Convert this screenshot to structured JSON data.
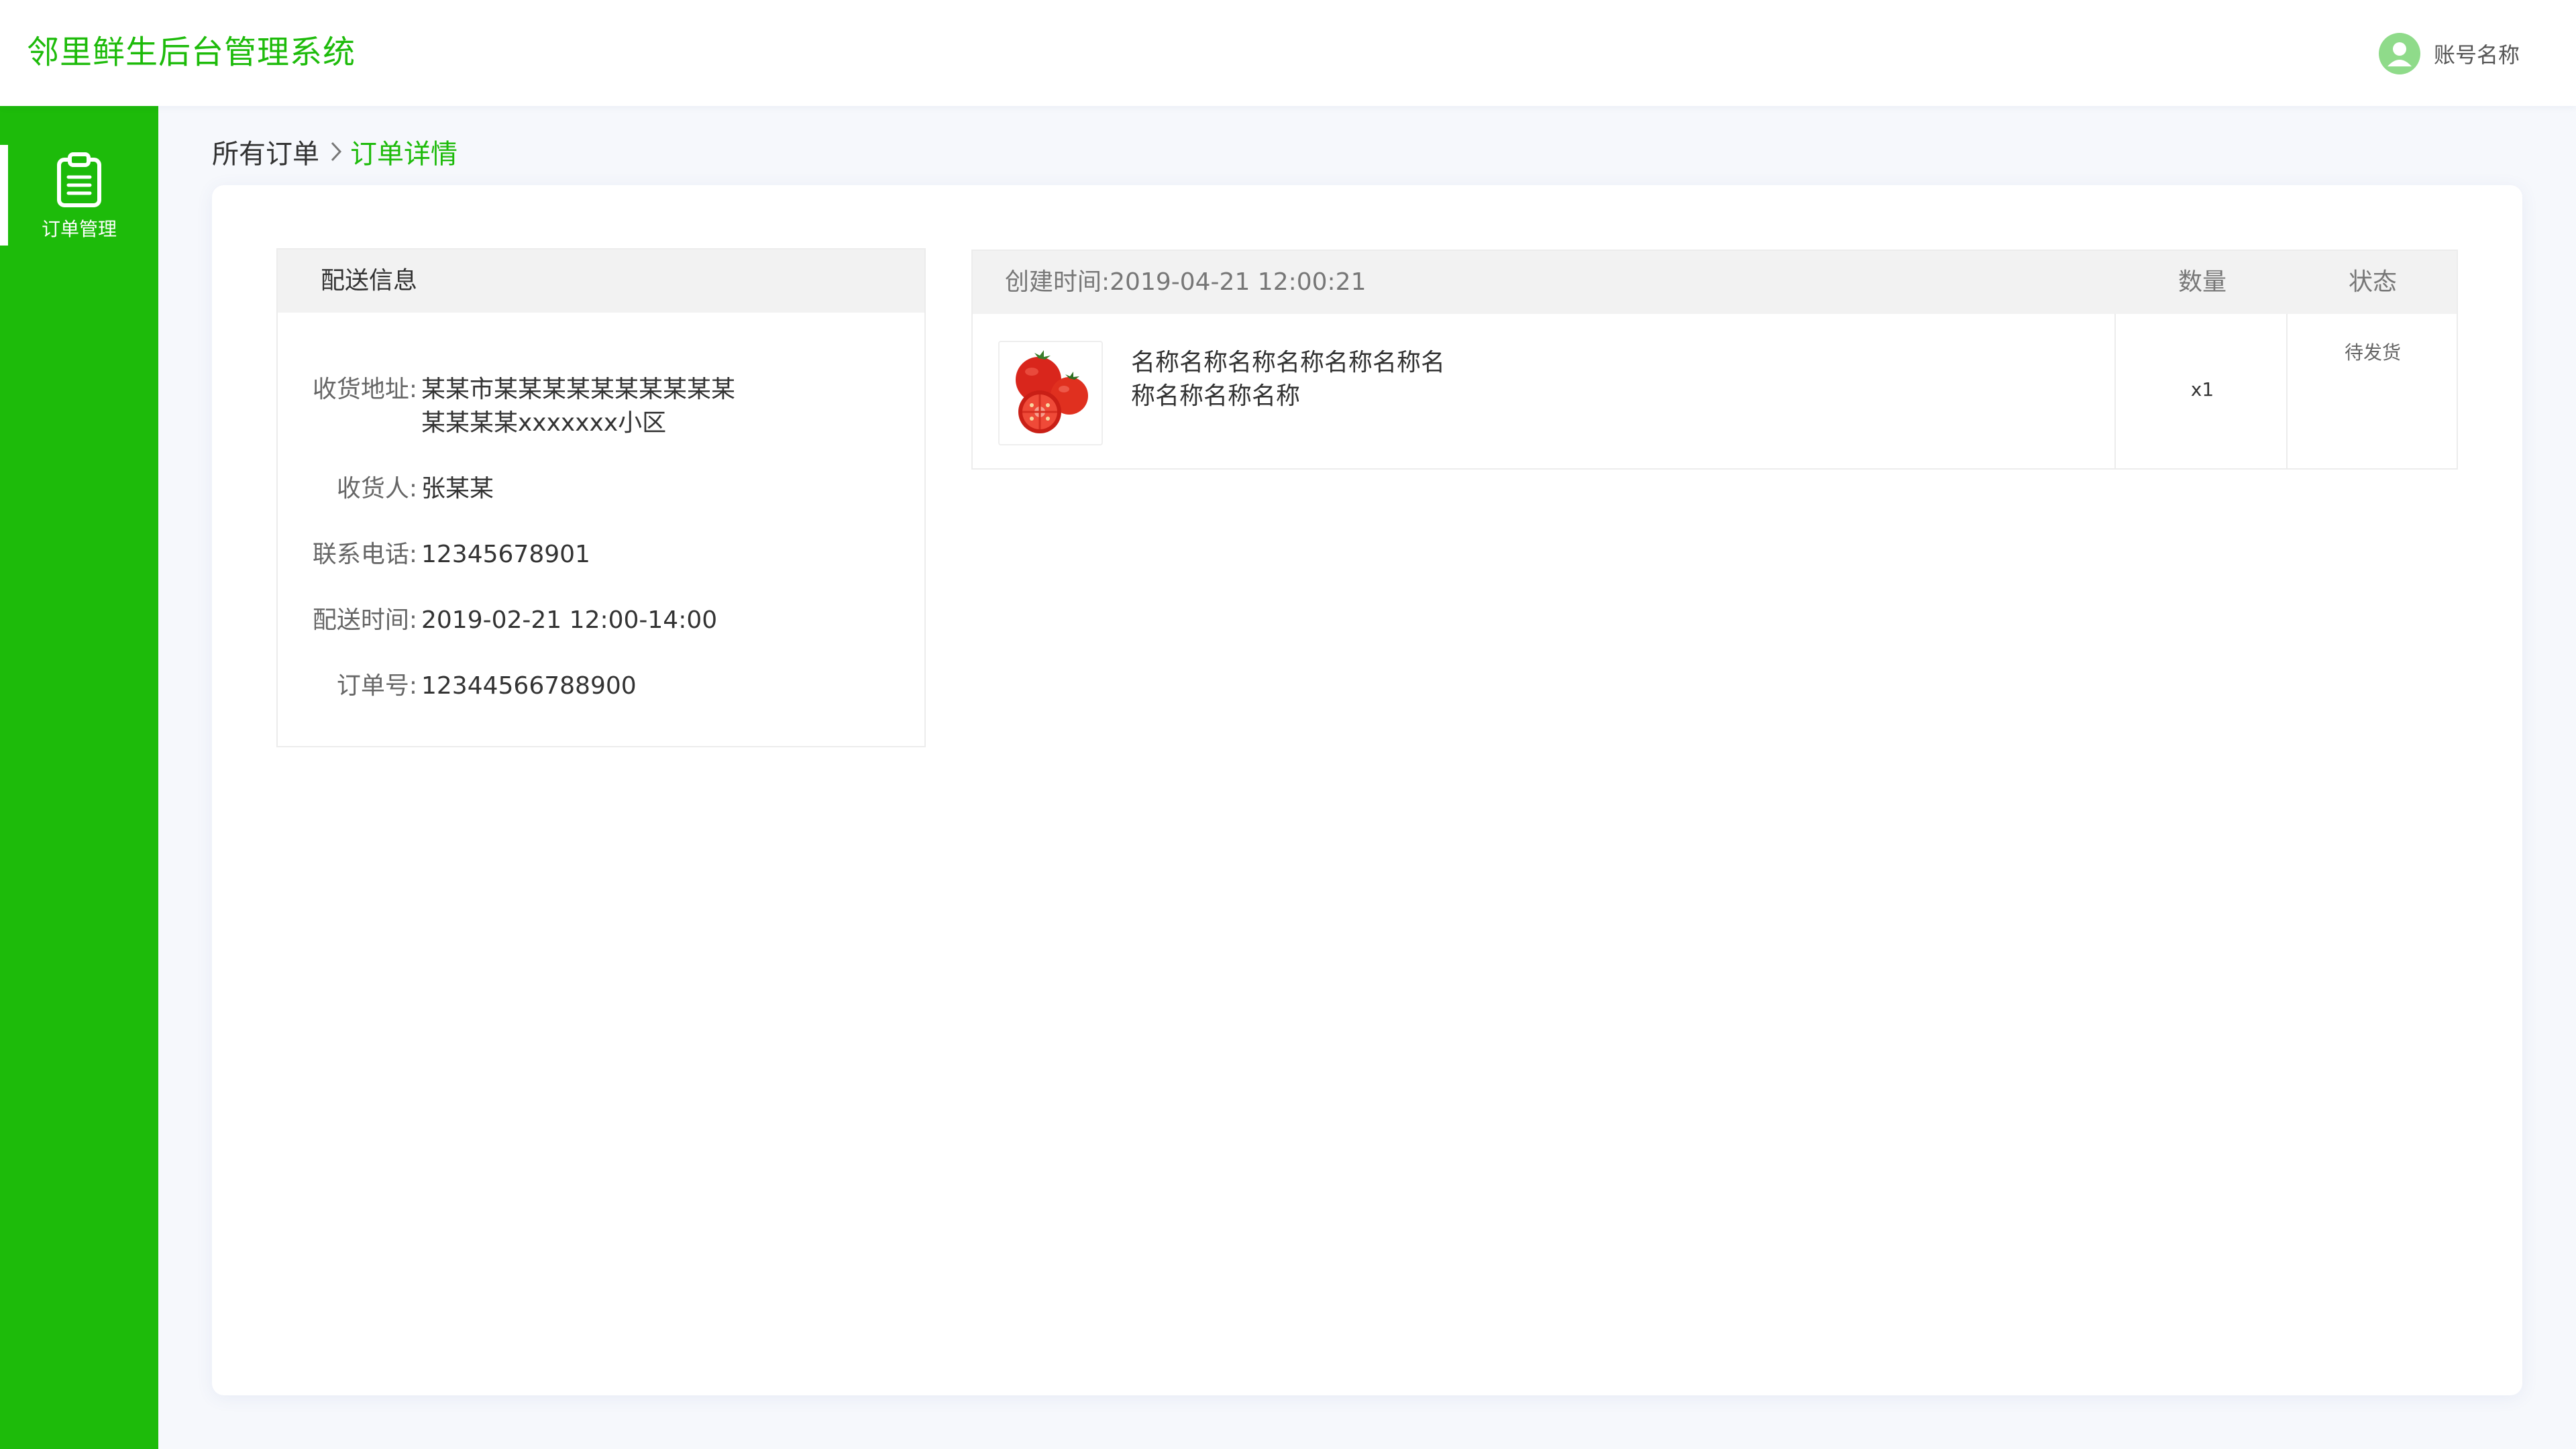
{
  "header": {
    "app_title": "邻里鲜生后台管理系统",
    "account_name": "账号名称",
    "avatar_icon": "user-avatar-icon"
  },
  "sidebar": {
    "items": [
      {
        "label": "订单管理",
        "icon": "clipboard-icon",
        "active": true
      }
    ]
  },
  "breadcrumb": {
    "parent": "所有订单",
    "separator_icon": "chevron-right-icon",
    "current": "订单详情"
  },
  "delivery": {
    "title": "配送信息",
    "address_label": "收货地址:",
    "address_value": "某某市某某某某某某某某某某某某某某xxxxxxx小区",
    "receiver_label": "收货人:",
    "receiver_value": "张某某",
    "phone_label": "联系电话:",
    "phone_value": "12345678901",
    "time_label": "配送时间:",
    "time_value": "2019-02-21 12:00-14:00",
    "order_no_label": "订单号:",
    "order_no_value": "12344566788900"
  },
  "order": {
    "created_label": "创建时间:",
    "created_value": "2019-04-21 12:00:21",
    "qty_header": "数量",
    "status_header": "状态",
    "items": [
      {
        "image_icon": "tomato-image",
        "name": "名称名称名称名称名称名称名称名称名称名称",
        "quantity": "x1",
        "status": "待发货"
      }
    ]
  },
  "colors": {
    "brand_green": "#1dbb0a",
    "avatar_green": "#8fdb8a",
    "panel_header_gray": "#f2f2f2"
  }
}
